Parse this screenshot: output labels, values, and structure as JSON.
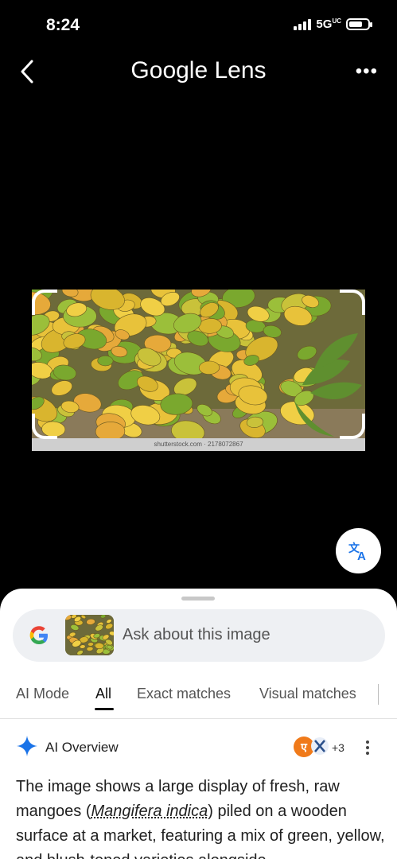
{
  "status": {
    "time": "8:24",
    "network": "5G",
    "network_suffix": "UC"
  },
  "header": {
    "title": "Google Lens",
    "more": "•••"
  },
  "image": {
    "credit": "shutterstock.com · 2178072867"
  },
  "search": {
    "placeholder": "Ask about this image"
  },
  "tabs": [
    {
      "label": "AI Mode"
    },
    {
      "label": "All"
    },
    {
      "label": "Exact matches"
    },
    {
      "label": "Visual matches"
    }
  ],
  "ai_overview": {
    "title": "AI Overview",
    "source_count": "+3",
    "text_before": "The image shows a large display of fresh, raw mangoes (",
    "text_italic": "Mangifera indica",
    "text_after": ") piled on a wooden surface at a market, featuring a mix of green, yellow, and blush-toned varieties alongside"
  },
  "colors": {
    "accent": "#1a73e8",
    "sheet_bg": "#ffffff",
    "screen_bg": "#000000"
  },
  "icons": [
    "back-chevron-icon",
    "more-icon",
    "translate-icon",
    "google-g-icon",
    "ai-sparkle-icon"
  ]
}
